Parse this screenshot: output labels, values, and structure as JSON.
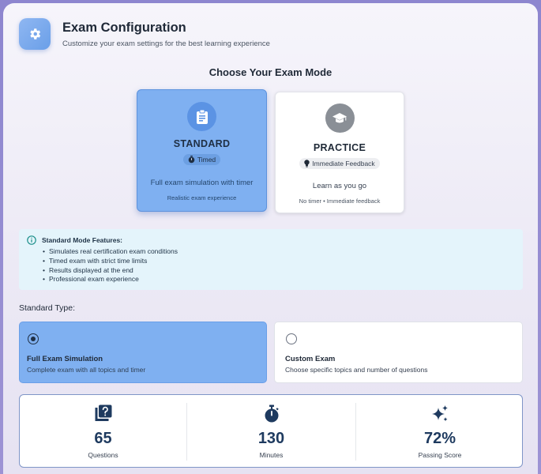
{
  "header": {
    "title": "Exam Configuration",
    "subtitle": "Customize your exam settings for the best learning experience",
    "icon": "gear-icon"
  },
  "modes": {
    "section_title": "Choose Your Exam Mode",
    "standard": {
      "name": "STANDARD",
      "badge": "Timed",
      "description": "Full exam simulation with timer",
      "note": "Realistic exam experience",
      "icon": "clipboard-icon",
      "selected": true
    },
    "practice": {
      "name": "PRACTICE",
      "badge": "Immediate Feedback",
      "description": "Learn as you go",
      "note": "No timer • Immediate feedback",
      "icon": "graduation-cap-icon",
      "selected": false
    }
  },
  "info": {
    "title": "Standard Mode Features:",
    "items": [
      "Simulates real certification exam conditions",
      "Timed exam with strict time limits",
      "Results displayed at the end",
      "Professional exam experience"
    ]
  },
  "standard_type": {
    "label": "Standard Type:",
    "options": [
      {
        "title": "Full Exam Simulation",
        "description": "Complete exam with all topics and timer",
        "selected": true
      },
      {
        "title": "Custom Exam",
        "description": "Choose specific topics and number of questions",
        "selected": false
      }
    ]
  },
  "stats": [
    {
      "value": "65",
      "label": "Questions",
      "icon": "question-book-icon"
    },
    {
      "value": "130",
      "label": "Minutes",
      "icon": "stopwatch-icon"
    },
    {
      "value": "72%",
      "label": "Passing Score",
      "icon": "sparkles-icon"
    }
  ],
  "colors": {
    "accent": "#7fb0f1",
    "accent_dark": "#5b93e4",
    "text_dark": "#1e3a5f",
    "info_bg": "#e4f4fb"
  }
}
